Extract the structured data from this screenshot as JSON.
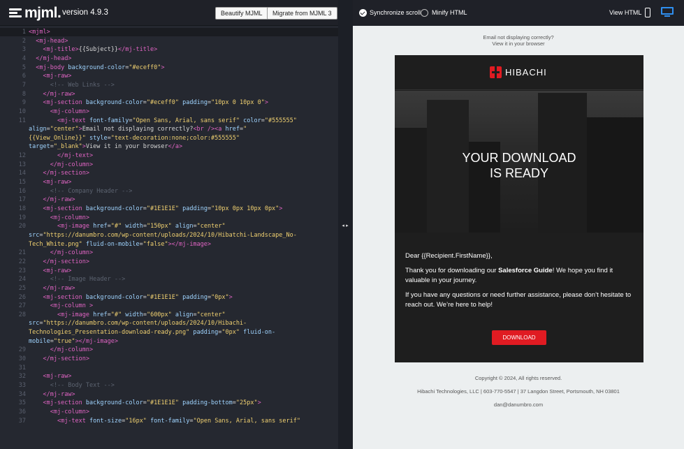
{
  "header": {
    "logo_text": "mjml.",
    "version": "version 4.9.3",
    "beautify_label": "Beautify MJML",
    "migrate_label": "Migrate from MJML 3"
  },
  "preview_toolbar": {
    "sync_label": "Synchronize scroll",
    "sync_checked": true,
    "minify_label": "Minify HTML",
    "minify_checked": false,
    "view_label": "View HTML",
    "active_color": "#2f8ff0"
  },
  "editor": {
    "lines": [
      {
        "n": "1",
        "html": "<span class='t'>&lt;mjml&gt;</span>"
      },
      {
        "n": "2",
        "html": "  <span class='t'>&lt;mj-head&gt;</span>"
      },
      {
        "n": "3",
        "html": "    <span class='t'>&lt;mj-title&gt;</span>{{Subject}}<span class='t'>&lt;/mj-title&gt;</span>"
      },
      {
        "n": "4",
        "html": "  <span class='t'>&lt;/mj-head&gt;</span>"
      },
      {
        "n": "5",
        "html": "  <span class='t'>&lt;mj-body</span> <span class='a'>background-color</span>=<span class='s'>\"#eceff0\"</span><span class='t'>&gt;</span>"
      },
      {
        "n": "6",
        "html": "    <span class='t'>&lt;mj-raw&gt;</span>"
      },
      {
        "n": "7",
        "html": "      <span class='c'>&lt;!-- Web Links --&gt;</span>"
      },
      {
        "n": "8",
        "html": "    <span class='t'>&lt;/mj-raw&gt;</span>"
      },
      {
        "n": "9",
        "html": "    <span class='t'>&lt;mj-section</span> <span class='a'>background-color</span>=<span class='s'>\"#eceff0\"</span> <span class='a'>padding</span>=<span class='s'>\"10px 0 10px 0\"</span><span class='t'>&gt;</span>"
      },
      {
        "n": "10",
        "html": "      <span class='t'>&lt;mj-column&gt;</span>"
      },
      {
        "n": "11",
        "html": "        <span class='t'>&lt;mj-text</span> <span class='a'>font-family</span>=<span class='s'>\"Open Sans, Arial, sans serif\"</span> <span class='a'>color</span>=<span class='s'>\"#555555\"</span>"
      },
      {
        "n": "",
        "html": "<span class='a'>align</span>=<span class='s'>\"center\"</span><span class='t'>&gt;</span>Email not displaying correctly?<span class='t'>&lt;br /&gt;</span><span class='t'>&lt;a</span> <span class='a'>href</span>=<span class='s'>\"</span>"
      },
      {
        "n": "",
        "html": "<span class='s'>{{View_Online}}\"</span> <span class='a'>style</span>=<span class='s'>\"text-decoration:none;color:#555555\"</span>"
      },
      {
        "n": "",
        "html": "<span class='a'>target</span>=<span class='s'>\"_blank\"</span><span class='t'>&gt;</span>View it in your browser<span class='t'>&lt;/a&gt;</span>"
      },
      {
        "n": "12",
        "html": "        <span class='t'>&lt;/mj-text&gt;</span>"
      },
      {
        "n": "13",
        "html": "      <span class='t'>&lt;/mj-column&gt;</span>"
      },
      {
        "n": "14",
        "html": "    <span class='t'>&lt;/mj-section&gt;</span>"
      },
      {
        "n": "15",
        "html": "    <span class='t'>&lt;mj-raw&gt;</span>"
      },
      {
        "n": "16",
        "html": "      <span class='c'>&lt;!-- Company Header --&gt;</span>"
      },
      {
        "n": "17",
        "html": "    <span class='t'>&lt;/mj-raw&gt;</span>"
      },
      {
        "n": "18",
        "html": "    <span class='t'>&lt;mj-section</span> <span class='a'>background-color</span>=<span class='s'>\"#1E1E1E\"</span> <span class='a'>padding</span>=<span class='s'>\"10px 0px 10px 0px\"</span><span class='t'>&gt;</span>"
      },
      {
        "n": "19",
        "html": "      <span class='t'>&lt;mj-column&gt;</span>"
      },
      {
        "n": "20",
        "html": "        <span class='t'>&lt;mj-image</span> <span class='a'>href</span>=<span class='s'>\"#\"</span> <span class='a'>width</span>=<span class='s'>\"150px\"</span> <span class='a'>align</span>=<span class='s'>\"center\"</span>"
      },
      {
        "n": "",
        "html": "<span class='a'>src</span>=<span class='s'>\"https://danumbro.com/wp-content/uploads/2024/10/Hibatchi-Landscape_No-</span>"
      },
      {
        "n": "",
        "html": "<span class='s'>Tech_White.png\"</span> <span class='a'>fluid-on-mobile</span>=<span class='s'>\"false\"</span><span class='t'>&gt;&lt;/mj-image&gt;</span>"
      },
      {
        "n": "21",
        "html": "      <span class='t'>&lt;/mj-column&gt;</span>"
      },
      {
        "n": "22",
        "html": "    <span class='t'>&lt;/mj-section&gt;</span>"
      },
      {
        "n": "23",
        "html": "    <span class='t'>&lt;mj-raw&gt;</span>"
      },
      {
        "n": "24",
        "html": "      <span class='c'>&lt;!-- Image Header --&gt;</span>"
      },
      {
        "n": "25",
        "html": "    <span class='t'>&lt;/mj-raw&gt;</span>"
      },
      {
        "n": "26",
        "html": "    <span class='t'>&lt;mj-section</span> <span class='a'>background-color</span>=<span class='s'>\"#1E1E1E\"</span> <span class='a'>padding</span>=<span class='s'>\"0px\"</span><span class='t'>&gt;</span>"
      },
      {
        "n": "27",
        "html": "      <span class='t'>&lt;mj-column</span> <span class='t'>&gt;</span>"
      },
      {
        "n": "28",
        "html": "        <span class='t'>&lt;mj-image</span> <span class='a'>href</span>=<span class='s'>\"#\"</span> <span class='a'>width</span>=<span class='s'>\"600px\"</span> <span class='a'>align</span>=<span class='s'>\"center\"</span>"
      },
      {
        "n": "",
        "html": "<span class='a'>src</span>=<span class='s'>\"https://danumbro.com/wp-content/uploads/2024/10/Hibachi-</span>"
      },
      {
        "n": "",
        "html": "<span class='s'>Technologies_Presentation-download-ready.png\"</span> <span class='a'>padding</span>=<span class='s'>\"0px\"</span> <span class='a'>fluid-on-</span>"
      },
      {
        "n": "",
        "html": "<span class='a'>mobile</span>=<span class='s'>\"true\"</span><span class='t'>&gt;&lt;/mj-image&gt;</span>"
      },
      {
        "n": "29",
        "html": "      <span class='t'>&lt;/mj-column&gt;</span>"
      },
      {
        "n": "30",
        "html": "    <span class='t'>&lt;/mj-section&gt;</span>"
      },
      {
        "n": "31",
        "html": ""
      },
      {
        "n": "32",
        "html": "    <span class='t'>&lt;mj-raw&gt;</span>"
      },
      {
        "n": "33",
        "html": "      <span class='c'>&lt;!-- Body Text --&gt;</span>"
      },
      {
        "n": "34",
        "html": "    <span class='t'>&lt;/mj-raw&gt;</span>"
      },
      {
        "n": "35",
        "html": "    <span class='t'>&lt;mj-section</span> <span class='a'>background-color</span>=<span class='s'>\"#1E1E1E\"</span> <span class='a'>padding-bottom</span>=<span class='s'>\"25px\"</span><span class='t'>&gt;</span>"
      },
      {
        "n": "36",
        "html": "      <span class='t'>&lt;mj-column&gt;</span>"
      },
      {
        "n": "37",
        "html": "        <span class='t'>&lt;mj-text</span> <span class='a'>font-size</span>=<span class='s'>\"16px\"</span> <span class='a'>font-family</span>=<span class='s'>\"Open Sans, Arial, sans serif\"</span>"
      }
    ]
  },
  "preview": {
    "preheader_line1": "Email not displaying correctly?",
    "preheader_line2": "View it in your browser",
    "brand_name": "HIBACHI",
    "brand_color": "#e01b22",
    "hero_line1": "YOUR DOWNLOAD",
    "hero_line2": "IS READY",
    "greeting": "Dear {{Recipient.FirstName}},",
    "para1_pre": "Thank you for downloading our ",
    "para1_bold": "Salesforce Guide",
    "para1_post": "! We hope you find it valuable in your journey.",
    "para2": "If you have any questions or need further assistance, please don’t hesitate to reach out. We’re here to help!",
    "download_label": "DOWNLOAD",
    "copyright": "Copyright © 2024, All rights reserved.",
    "address": "Hibachi Technologies, LLC | 603-770-5547 | 37 Langdon Street, Portsmouth, NH 03801",
    "email": "dan@danumbro.com"
  }
}
